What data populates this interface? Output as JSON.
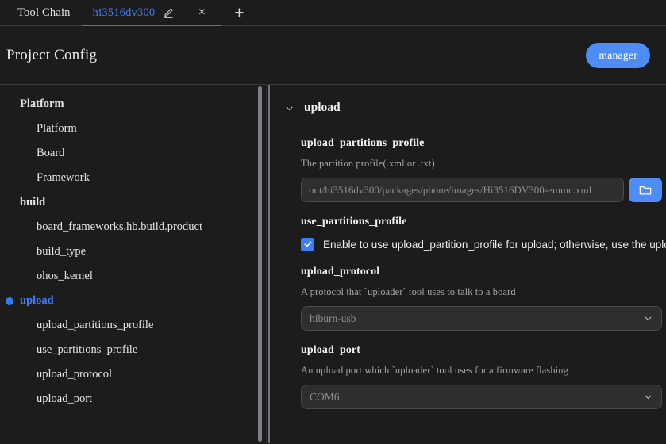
{
  "window": {
    "accent_color": "#4d8df5",
    "background_color": "#1c1c1c"
  },
  "tabbar": {
    "tabs": [
      {
        "label": "Tool Chain",
        "active": false
      },
      {
        "label": "hi3516dv300",
        "active": true
      }
    ],
    "edit_icon": "pencil-icon",
    "close_icon": "close-icon",
    "close_label": "×",
    "add_icon": "plus-icon",
    "add_label": "+"
  },
  "header": {
    "title": "Project Config",
    "manager_label": "manager"
  },
  "sidebar": {
    "items": [
      {
        "label": "Platform",
        "type": "group",
        "selected": false
      },
      {
        "label": "Platform",
        "type": "child",
        "selected": false
      },
      {
        "label": "Board",
        "type": "child",
        "selected": false
      },
      {
        "label": "Framework",
        "type": "child",
        "selected": false
      },
      {
        "label": "build",
        "type": "group",
        "selected": false
      },
      {
        "label": "board_frameworks.hb.build.product",
        "type": "child",
        "selected": false
      },
      {
        "label": "build_type",
        "type": "child",
        "selected": false
      },
      {
        "label": "ohos_kernel",
        "type": "child",
        "selected": false
      },
      {
        "label": "upload",
        "type": "group",
        "selected": true
      },
      {
        "label": "upload_partitions_profile",
        "type": "child",
        "selected": false
      },
      {
        "label": "use_partitions_profile",
        "type": "child",
        "selected": false
      },
      {
        "label": "upload_protocol",
        "type": "child",
        "selected": false
      },
      {
        "label": "upload_port",
        "type": "child",
        "selected": false
      }
    ]
  },
  "content": {
    "section": {
      "title": "upload",
      "expanded": true,
      "chevron_icon": "chevron-down-icon"
    },
    "fields": [
      {
        "name": "upload_partitions_profile",
        "label": "upload_partitions_profile",
        "description": "The partition profile(.xml or .txt)",
        "type": "file",
        "value": "",
        "placeholder": "out/hi3516dv300/packages/phone/images/Hi3516DV300-emmc.xml",
        "browse_icon": "folder-icon"
      },
      {
        "name": "use_partitions_profile",
        "label": "use_partitions_profile",
        "type": "checkbox",
        "checked": true,
        "checkbox_label": "Enable to use upload_partition_profile for upload; otherwise, use the upload_par"
      },
      {
        "name": "upload_protocol",
        "label": "upload_protocol",
        "description": "A protocol that `uploader` tool uses to talk to a board",
        "type": "select",
        "value": "hiburn-usb",
        "caret_icon": "chevron-down-icon"
      },
      {
        "name": "upload_port",
        "label": "upload_port",
        "description": "An upload port which `uploader` tool uses for a firmware flashing",
        "type": "select",
        "value": "COM6",
        "caret_icon": "chevron-down-icon"
      }
    ]
  }
}
